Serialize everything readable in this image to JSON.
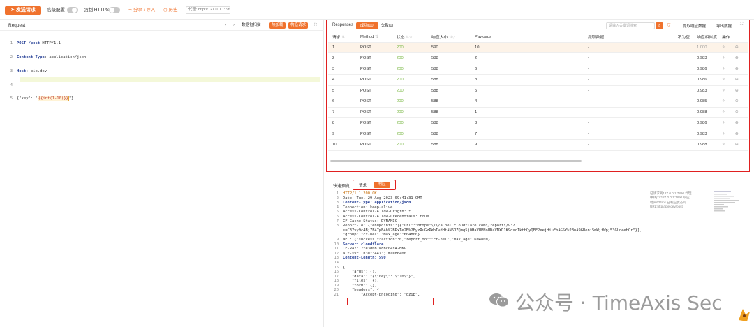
{
  "topbar": {
    "send_label": "发送请求",
    "advanced_label": "高级配置",
    "force_https_label": "强制 HTTPS",
    "share_label": "分享 / 导入",
    "history_label": "历史",
    "proxy_text": "代理: http://127.0.0.1:7890"
  },
  "request": {
    "title": "Request",
    "packet_scan": "数据包扫描",
    "hotload": "热加载",
    "construct": "构造请求",
    "lines": [
      {
        "n": "1",
        "text": "POST /post HTTP/1.1"
      },
      {
        "n": "2",
        "text": "Content-Type: application/json"
      },
      {
        "n": "3",
        "text": "Host: pie.dev"
      },
      {
        "n": "4",
        "text": ""
      },
      {
        "n": "5",
        "text": "{\"key\": \"{{int(1-10)}}\"}"
      }
    ]
  },
  "responses": {
    "title": "Responses",
    "success_tab": "成功[10]",
    "fail_tab": "失败[0]",
    "search_placeholder": "请输入关键词搜索",
    "extract_label": "提取响应数据",
    "export_label": "导出数据",
    "columns": [
      "请求",
      "Method",
      "状态",
      "响应大小",
      "Payloads",
      "提取数据",
      "不为空",
      "响应相似度",
      "操作"
    ],
    "rows": [
      {
        "id": "1",
        "method": "POST",
        "status": "200",
        "size": "590",
        "payload": "10",
        "extract": "-",
        "sim": "1.000"
      },
      {
        "id": "2",
        "method": "POST",
        "status": "200",
        "size": "588",
        "payload": "2",
        "extract": "-",
        "sim": "0.983"
      },
      {
        "id": "3",
        "method": "POST",
        "status": "200",
        "size": "588",
        "payload": "6",
        "extract": "-",
        "sim": "0.986"
      },
      {
        "id": "4",
        "method": "POST",
        "status": "200",
        "size": "588",
        "payload": "8",
        "extract": "-",
        "sim": "0.986"
      },
      {
        "id": "5",
        "method": "POST",
        "status": "200",
        "size": "588",
        "payload": "5",
        "extract": "-",
        "sim": "0.983"
      },
      {
        "id": "6",
        "method": "POST",
        "status": "200",
        "size": "588",
        "payload": "4",
        "extract": "-",
        "sim": "0.985"
      },
      {
        "id": "7",
        "method": "POST",
        "status": "200",
        "size": "588",
        "payload": "1",
        "extract": "-",
        "sim": "0.988"
      },
      {
        "id": "8",
        "method": "POST",
        "status": "200",
        "size": "588",
        "payload": "3",
        "extract": "-",
        "sim": "0.986"
      },
      {
        "id": "9",
        "method": "POST",
        "status": "200",
        "size": "588",
        "payload": "7",
        "extract": "-",
        "sim": "0.983"
      },
      {
        "id": "10",
        "method": "POST",
        "status": "200",
        "size": "588",
        "payload": "9",
        "extract": "-",
        "sim": "0.988"
      }
    ]
  },
  "preview": {
    "title": "快速预览",
    "request_tab": "请求",
    "response_tab": "响应",
    "side_note": "已请求到127.0.0.1:7890 代理中转p://127.0.0.1:7890 响应时间624ms 已响应状态码 URL:http://pie.dev/post",
    "lines": [
      {
        "n": "1",
        "text": "HTTP/1.1 200 OK"
      },
      {
        "n": "2",
        "text": "Date: Tue, 29 Aug 2023 09:41:31 GMT"
      },
      {
        "n": "3",
        "text": "Content-Type: application/json"
      },
      {
        "n": "4",
        "text": "Connection: keep-alive"
      },
      {
        "n": "5",
        "text": "Access-Control-Allow-Origin: *"
      },
      {
        "n": "6",
        "text": "Access-Control-Allow-Credentials: true"
      },
      {
        "n": "7",
        "text": "CF-Cache-Status: DYNAMIC"
      },
      {
        "n": "8",
        "text": "Report-To: {\"endpoints\":[{\"url\":\"https:\\/\\/a.nel.cloudflare.com\\/report\\/v3?"
      },
      {
        "n": "",
        "text": "s=C37vy9c4BjZE47pB4h%2BPxTe2B%2FyzRuGzPWoIvdHtAN6JZQmq5j0HaVUPNoUDaVNXD1K9oxcIktbQyQFF2eejdiuEbAGSY%2BnA9GBeni5mWjfWpj53GUneebCr\"}],"
      },
      {
        "n": "",
        "text": "\"group\":\"cf-nel\",\"max_age\":604800}"
      },
      {
        "n": "9",
        "text": "NEL: {\"success_fraction\":0,\"report_to\":\"cf-nel\",\"max_age\":604800}"
      },
      {
        "n": "10",
        "text": "Server: cloudflare"
      },
      {
        "n": "11",
        "text": "CF-RAY: 7fe3d6b788bc04f4-HKG"
      },
      {
        "n": "12",
        "text": "alt-svc: h3=\":443\"; ma=86400"
      },
      {
        "n": "13",
        "text": "Content-Length: 590"
      },
      {
        "n": "14",
        "text": ""
      },
      {
        "n": "15",
        "text": "{"
      },
      {
        "n": "16",
        "text": "    \"args\": {},"
      },
      {
        "n": "17",
        "text": "    \"data\": \"{\\\"key\\\": \\\"10\\\"}\","
      },
      {
        "n": "18",
        "text": "    \"files\": {},"
      },
      {
        "n": "19",
        "text": "    \"form\": {},"
      },
      {
        "n": "20",
        "text": "    \"headers\": {"
      },
      {
        "n": "21",
        "text": "        \"Accept-Encoding\": \"gzip\","
      }
    ]
  },
  "watermark": "公众号 · TimeAxis Sec",
  "colors": {
    "accent": "#f0722d",
    "highlight_border": "#e02020",
    "status_green": "#7ab844"
  }
}
